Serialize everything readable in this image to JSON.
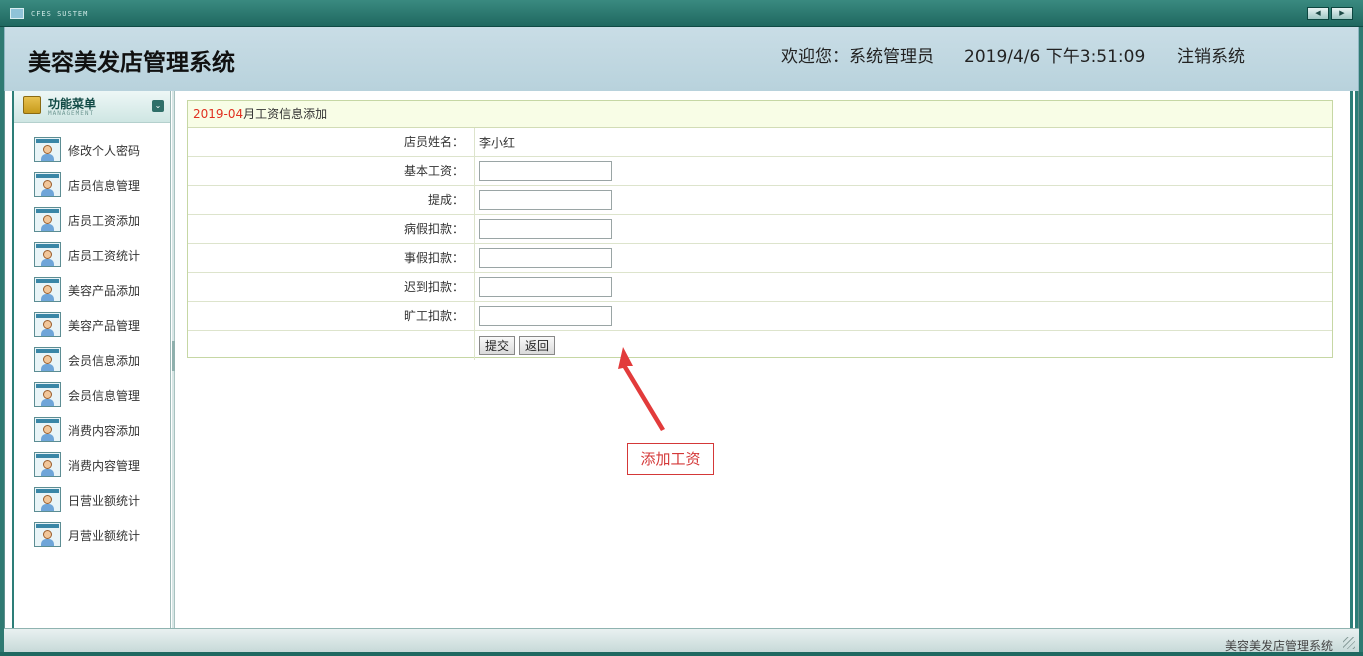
{
  "window": {
    "system_label": "CFES SUSTEM"
  },
  "header": {
    "title": "美容美发店管理系统",
    "welcome": "欢迎您：系统管理员",
    "datetime": "2019/4/6 下午3:51:09",
    "logout": "注销系统"
  },
  "sidebar": {
    "menu_title": "功能菜单",
    "menu_subtitle": "MANAGEMENT",
    "items": [
      {
        "label": "修改个人密码"
      },
      {
        "label": "店员信息管理"
      },
      {
        "label": "店员工资添加"
      },
      {
        "label": "店员工资统计"
      },
      {
        "label": "美容产品添加"
      },
      {
        "label": "美容产品管理"
      },
      {
        "label": "会员信息添加"
      },
      {
        "label": "会员信息管理"
      },
      {
        "label": "消费内容添加"
      },
      {
        "label": "消费内容管理"
      },
      {
        "label": "日营业额统计"
      },
      {
        "label": "月营业额统计"
      }
    ]
  },
  "form": {
    "title_month": "2019-04",
    "title_rest": "月工资信息添加",
    "employee_label": "店员姓名：",
    "employee_name": "李小红",
    "fields": [
      {
        "label": "基本工资：",
        "value": ""
      },
      {
        "label": "提成：",
        "value": ""
      },
      {
        "label": "病假扣款：",
        "value": ""
      },
      {
        "label": "事假扣款：",
        "value": ""
      },
      {
        "label": "迟到扣款：",
        "value": ""
      },
      {
        "label": "旷工扣款：",
        "value": ""
      }
    ],
    "submit_label": "提交",
    "back_label": "返回"
  },
  "annotation": {
    "text": "添加工资",
    "color": "#d43838"
  },
  "footer": {
    "text": "美容美发店管理系统"
  },
  "colors": {
    "accent": "#2d7e78",
    "header_bg": "#c3d9e2",
    "title_red": "#e03020"
  }
}
